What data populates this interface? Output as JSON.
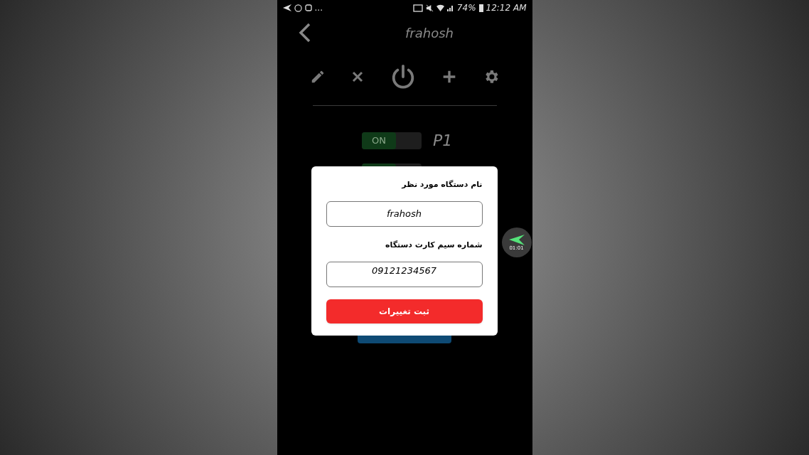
{
  "status_bar": {
    "more": "...",
    "battery": "74%",
    "time": "12:12 AM"
  },
  "header": {
    "title": "frahosh"
  },
  "toolbar": [
    {
      "kind": "edit"
    },
    {
      "kind": "delete"
    },
    {
      "kind": "power"
    },
    {
      "kind": "add"
    },
    {
      "kind": "settings"
    }
  ],
  "switches": [
    {
      "on_label": "ON",
      "on": true,
      "label": "P1"
    },
    {
      "on": true
    }
  ],
  "floating_widget": {
    "time": "01:01"
  },
  "dialog": {
    "fields": [
      {
        "label": "نام دستگاه مورد نظر",
        "value": "frahosh"
      },
      {
        "label": "شماره سیم کارت دستگاه",
        "value": "09121234567"
      }
    ],
    "submit": "ثبت تغییرات"
  }
}
